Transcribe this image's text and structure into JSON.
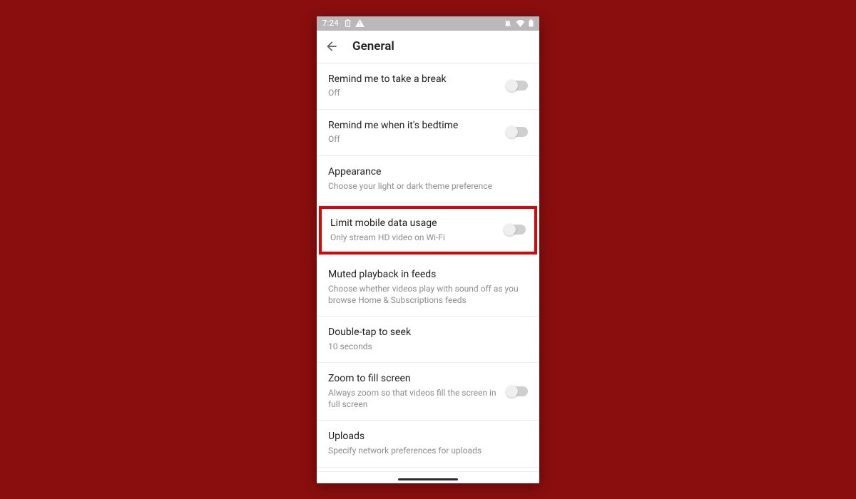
{
  "statusbar": {
    "time": "7:24"
  },
  "appbar": {
    "title": "General"
  },
  "rows": {
    "break": {
      "title": "Remind me to take a break",
      "sub": "Off"
    },
    "bedtime": {
      "title": "Remind me when it's bedtime",
      "sub": "Off"
    },
    "appearance": {
      "title": "Appearance",
      "sub": "Choose your light or dark theme preference"
    },
    "limitdata": {
      "title": "Limit mobile data usage",
      "sub": "Only stream HD video on Wi-Fi"
    },
    "muted": {
      "title": "Muted playback in feeds",
      "sub": "Choose whether videos play with sound off as you browse Home & Subscriptions feeds"
    },
    "doubletap": {
      "title": "Double-tap to seek",
      "sub": "10 seconds"
    },
    "zoom": {
      "title": "Zoom to fill screen",
      "sub": "Always zoom so that videos fill the screen in full screen"
    },
    "uploads": {
      "title": "Uploads",
      "sub": "Specify network preferences for uploads"
    }
  }
}
